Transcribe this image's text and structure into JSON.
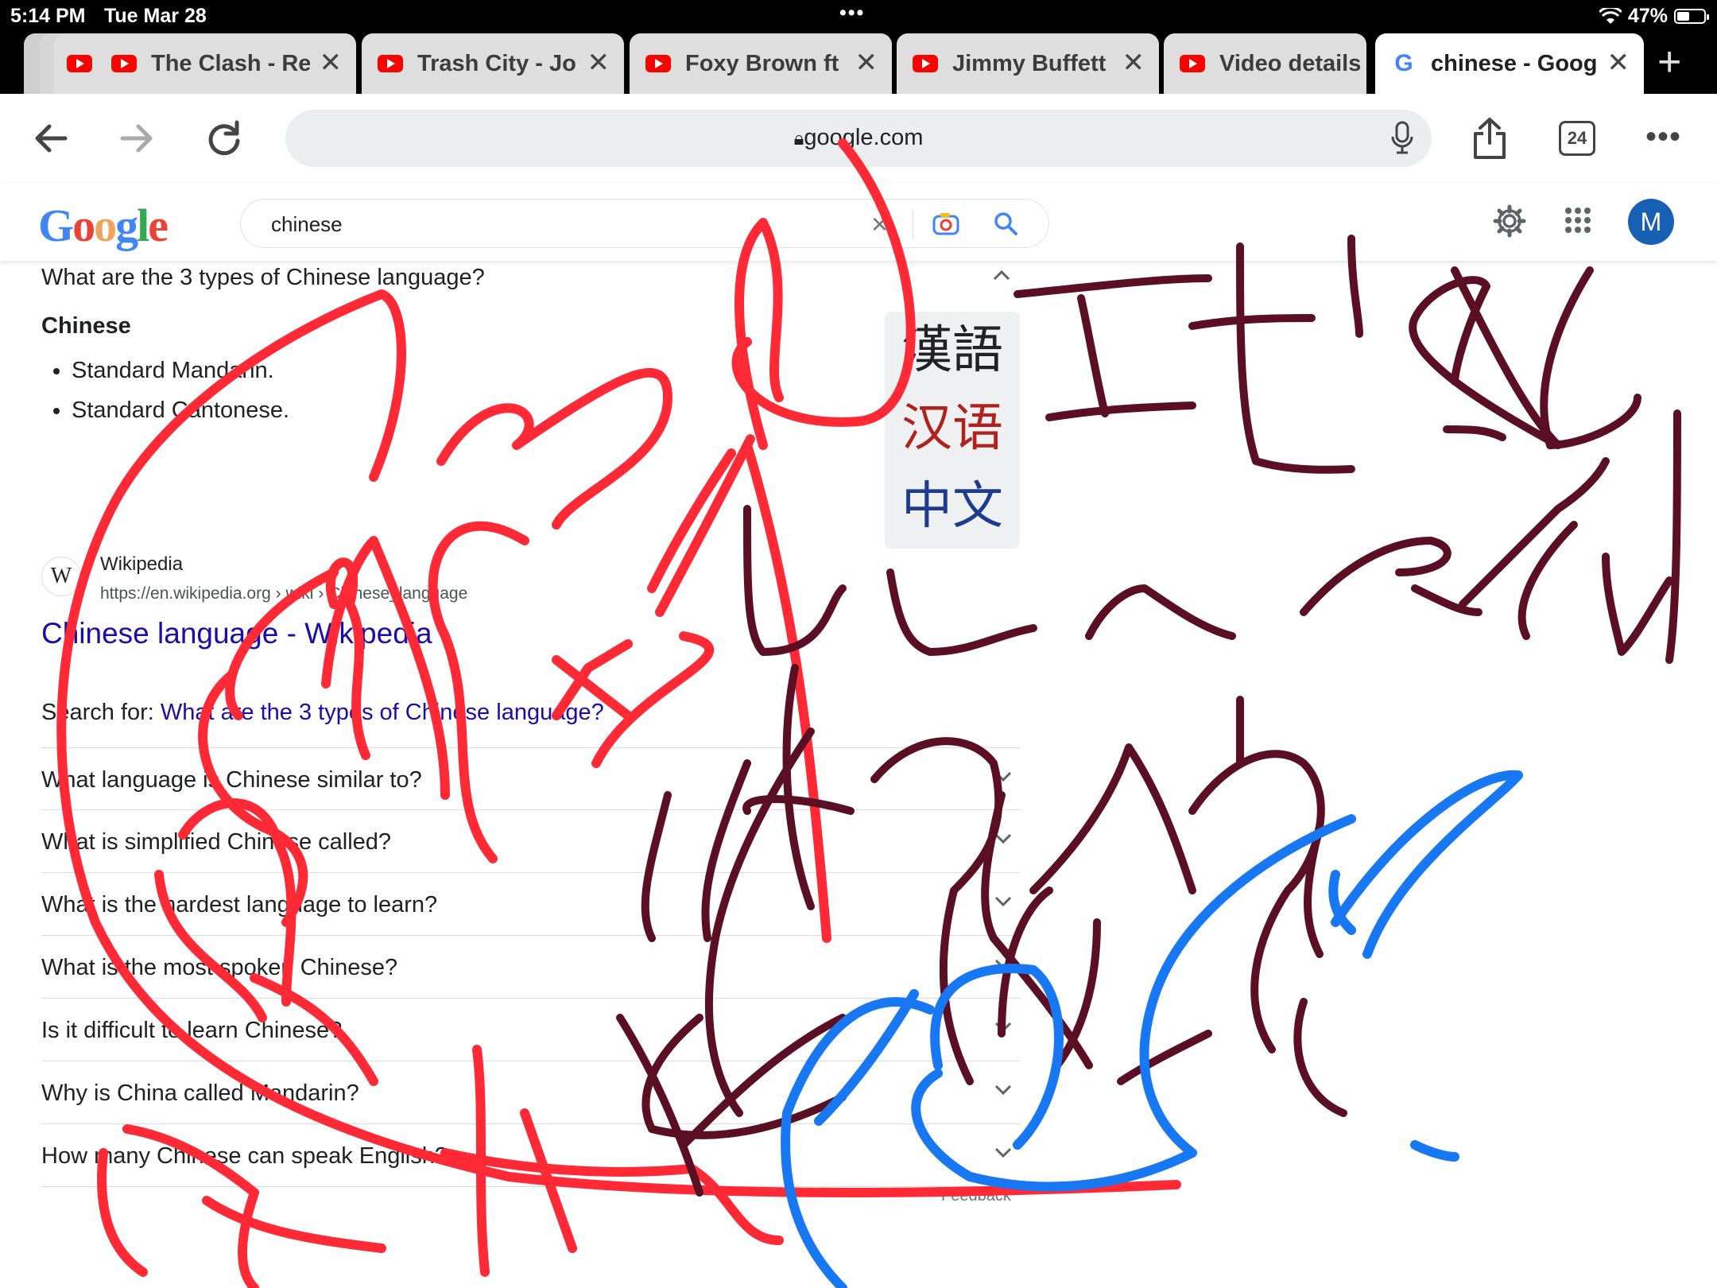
{
  "status_bar": {
    "time": "5:14 PM",
    "date": "Tue Mar 28",
    "battery": "47%",
    "battery_fraction": 0.47
  },
  "tabs": [
    {
      "title": "The Clash - Re",
      "icon": "youtube-icon"
    },
    {
      "title": "Trash City - Jo",
      "icon": "youtube-icon"
    },
    {
      "title": "Foxy Brown ft",
      "icon": "youtube-icon"
    },
    {
      "title": "Jimmy Buffett",
      "icon": "youtube-icon"
    },
    {
      "title": "Video details",
      "icon": "youtube-icon"
    },
    {
      "title": "chinese - Goog",
      "icon": "google-icon",
      "active": true
    }
  ],
  "toolbar": {
    "url": "google.com",
    "tab_count": "24"
  },
  "search": {
    "query": "chinese"
  },
  "account": {
    "initial": "M"
  },
  "featured": {
    "question": "What are the 3 types of Chinese language?",
    "heading": "Chinese",
    "bullets": [
      "Standard Mandarin.",
      "Standard Cantonese."
    ],
    "hanzi": [
      "漢語",
      "汉语",
      "中文"
    ]
  },
  "wiki_result": {
    "badge": "W",
    "source": "Wikipedia",
    "url": "https://en.wikipedia.org › wiki › Chinese_language",
    "title": "Chinese language - Wikipedia",
    "search_for_label": "Search for: ",
    "search_for_link": "What are the 3 types of Chinese language?"
  },
  "people_also_ask": [
    "What language is Chinese similar to?",
    "What is simplified Chinese called?",
    "What is the hardest language to learn?",
    "What is the most spoken Chinese?",
    "Is it difficult to learn Chinese?",
    "Why is China called Mandarin?",
    "How many Chinese can speak English?"
  ],
  "feedback_label": "Feedback",
  "handwriting": {
    "text": "It'll be a cold day?"
  },
  "colors": {
    "accent": "#1a0dab",
    "ink_red": "#ff2a36",
    "ink_maroon": "#5a0f24",
    "ink_blue": "#1877f2"
  }
}
